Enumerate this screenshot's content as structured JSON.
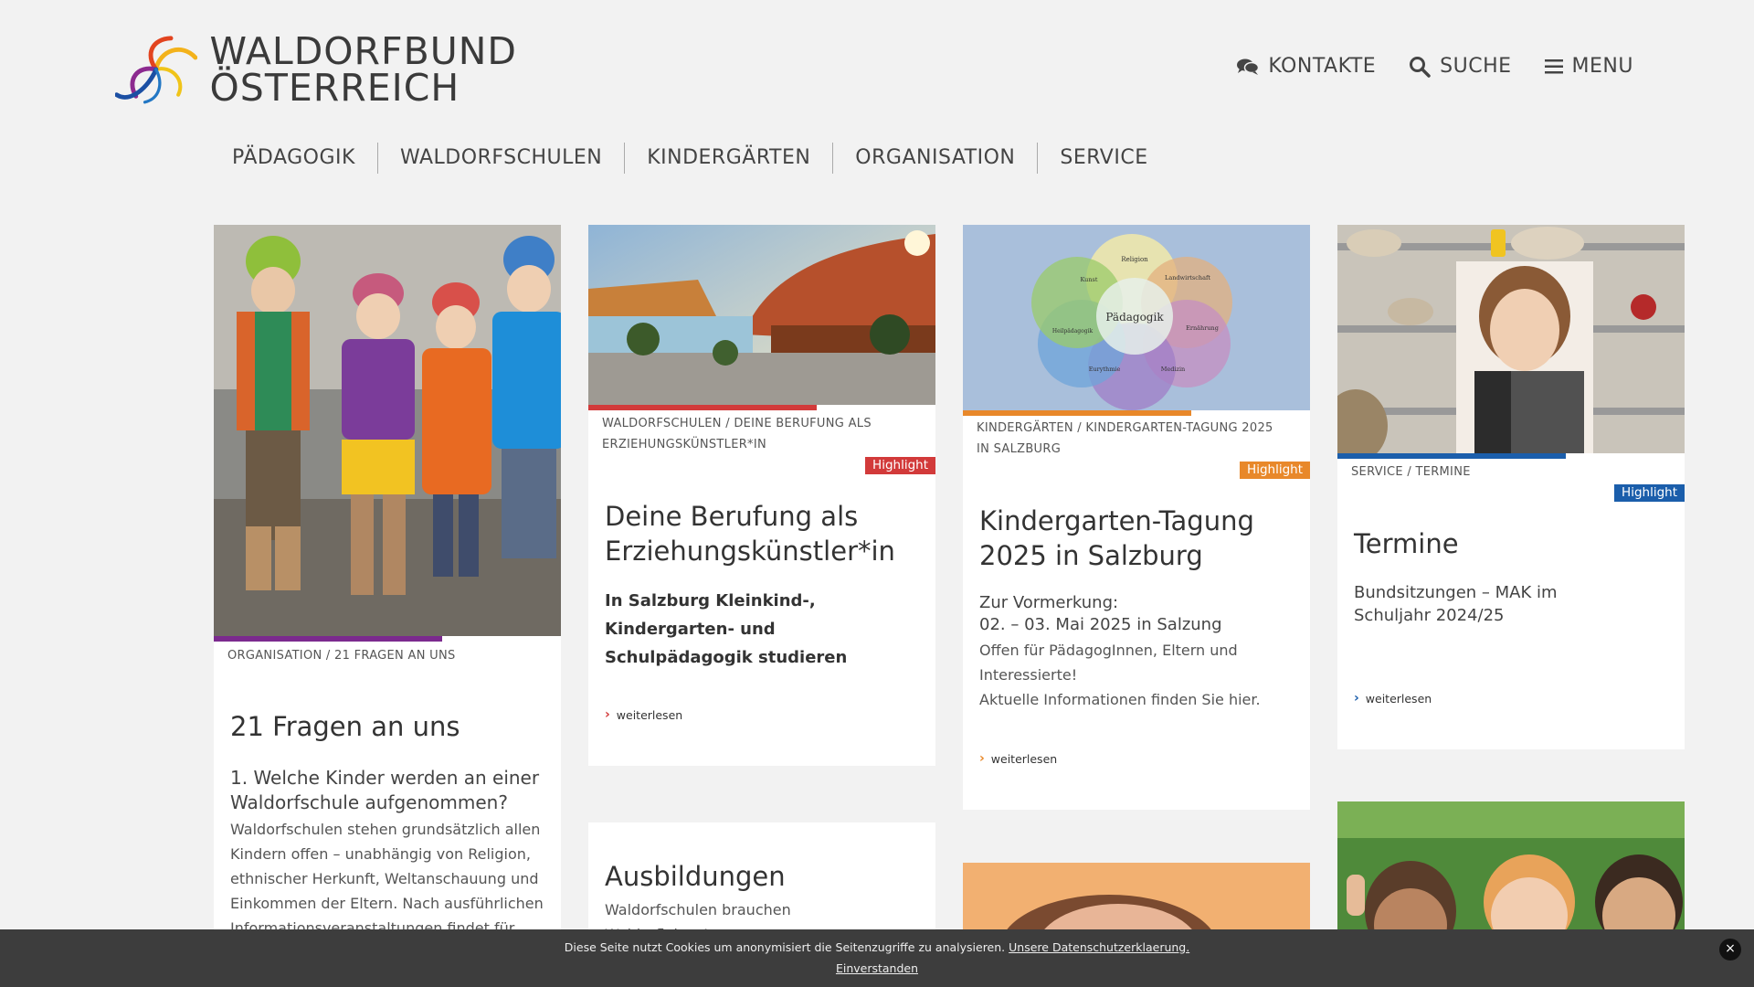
{
  "logo": {
    "line1": "WALDORFBUND",
    "line2": "ÖSTERREICH"
  },
  "top_links": {
    "contacts": "KONTAKTE",
    "search": "SUCHE",
    "menu": "MENU"
  },
  "nav": [
    "PÄDAGOGIK",
    "WALDORFSCHULEN",
    "KINDERGÄRTEN",
    "ORGANISATION",
    "SERVICE"
  ],
  "cards": [
    {
      "breadcrumb": "ORGANISATION / 21 FRAGEN AN UNS",
      "title": "21 Fragen an uns",
      "question": "1. Welche Kinder werden an einer Waldorfschule aufgenommen?",
      "text": "Waldorfschulen stehen grundsätzlich allen Kindern offen – unabhängig von Religion, ethnischer Herkunft, Weltanschauung und Einkommen der Eltern. Nach ausführlichen Informationsveranstaltungen findet für jedes",
      "accent": "#7b2a8e"
    },
    {
      "breadcrumb": "WALDORFSCHULEN / DEINE BERUFUNG ALS ERZIEHUNGSKÜNSTLER*IN",
      "highlight": "Highlight",
      "title": "Deine Berufung als Erziehungskünstler*in",
      "subtitle": "In Salzburg Kleinkind-, Kindergarten- und Schulpädagogik studieren",
      "more": "weiterlesen",
      "accent": "#d23a3a"
    },
    {
      "breadcrumb": "KINDERGÄRTEN / KINDERGARTEN-TAGUNG 2025 IN SALZBURG",
      "highlight": "Highlight",
      "title": "Kindergarten-Tagung 2025 in Salzburg",
      "line1": "Zur Vormerkung:",
      "line2": "02. – 03. Mai 2025 in Salzung",
      "line3": "Offen für PädagogInnen, Eltern und Interessierte!",
      "line4": "Aktuelle Informationen finden Sie hier.",
      "more": "weiterlesen",
      "accent": "#e8882a",
      "diagram": {
        "center": "Pädagogik",
        "labels": [
          "Religion",
          "Landwirtschaft",
          "Ernährung",
          "Medizin",
          "Eurythmie",
          "Heilpädagogik",
          "Kunst"
        ]
      }
    },
    {
      "breadcrumb": "SERVICE / TERMINE",
      "highlight": "Highlight",
      "title": "Termine",
      "text": "Bundsitzungen – MAK im Schuljahr 2024/25",
      "more": "weiterlesen",
      "accent": "#1b5eab"
    },
    {
      "title": "Ausbildungen",
      "text": "Waldorfschulen brauchen WaldorflehrerInnen"
    }
  ],
  "cookie": {
    "text": "Diese Seite nutzt Cookies um anonymisiert die Seitenzugriffe zu analysieren.",
    "link": "Unsere Datenschutzerklaerung.",
    "accept": "Einverstanden",
    "close": "×"
  }
}
